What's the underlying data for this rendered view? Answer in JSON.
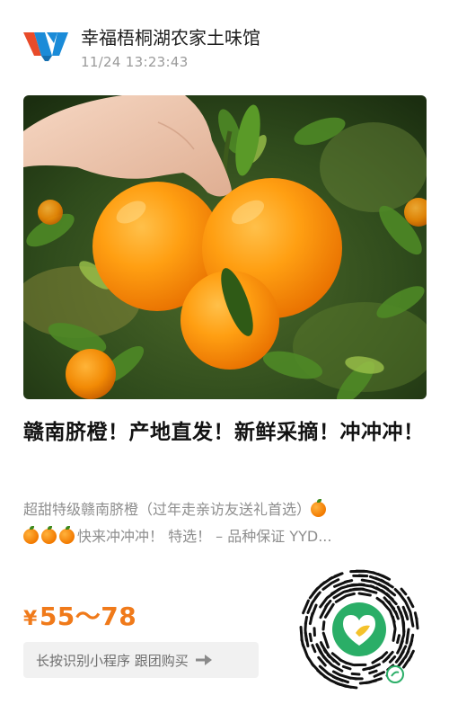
{
  "header": {
    "shop_name": "幸福梧桐湖农家土味馆",
    "timestamp": "11/24 13:23:43"
  },
  "product": {
    "title": "赣南脐橙！产地直发！新鲜采摘！冲冲冲！",
    "desc_line1": "超甜特级赣南脐橙（过年走亲访友送礼首选）",
    "desc_line2": "快来冲冲冲！ 特选！ – 品种保证 YYD...",
    "price_currency": "¥",
    "price_range": "55～78"
  },
  "cta": {
    "label": "长按识别小程序 跟团购买",
    "icon": "arrow-right-icon"
  },
  "icons": {
    "logo": "shop-logo",
    "qr": "mini-program-code",
    "emoji": "orange-emoji"
  },
  "colors": {
    "accent": "#f07a1a",
    "brand_logo": "#1a8bd8",
    "mini_program_green": "#2aae67"
  }
}
